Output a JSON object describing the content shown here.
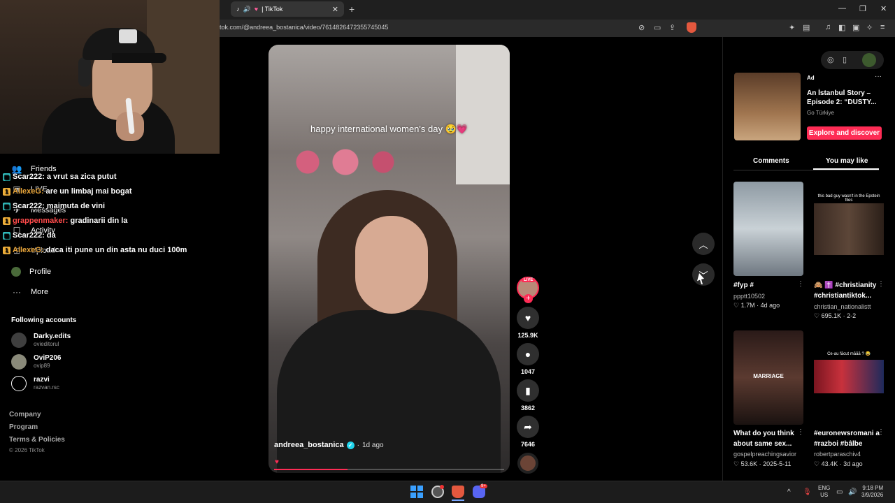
{
  "browser": {
    "tab_title": "| TikTok",
    "url": "tok.com/@andreea_bostanica/video/7614826472355745045",
    "tab_close": "✕",
    "new_tab": "+",
    "win_min": "—",
    "win_max": "❐",
    "win_close": "✕"
  },
  "sidebar": {
    "items": [
      {
        "label": "Friends",
        "icon": "friends-icon"
      },
      {
        "label": "LIVE",
        "icon": "live-icon"
      },
      {
        "label": "Messages",
        "icon": "messages-icon"
      },
      {
        "label": "Activity",
        "icon": "activity-icon"
      },
      {
        "label": "Upload",
        "icon": "upload-icon"
      },
      {
        "label": "Profile",
        "icon": "profile-icon"
      },
      {
        "label": "More",
        "icon": "more-icon"
      }
    ],
    "following_title": "Following accounts",
    "accounts": [
      {
        "name": "Darky.edits",
        "handle": "ovieditorul"
      },
      {
        "name": "OviP206",
        "handle": "ovip89"
      },
      {
        "name": "razvi",
        "handle": "razvan.rsc"
      }
    ],
    "footer": [
      "Company",
      "Program",
      "Terms & Policies"
    ],
    "copyright": "© 2026 TikTok"
  },
  "chat": [
    {
      "user": "Scar222:",
      "msg": "a vrut sa zica putut",
      "color": "#ffffff",
      "badge": "▦",
      "badge_color": "#33c2c2"
    },
    {
      "user": "AllexeG:",
      "msg": "are un limbaj mai bogat",
      "color": "#e8a53a",
      "badge": "1",
      "badge_color": "#f0b03a"
    },
    {
      "user": "Scar222:",
      "msg": "maimuta de vini",
      "color": "#ffffff",
      "badge": "▦",
      "badge_color": "#33c2c2"
    },
    {
      "user": "grappenmaker:",
      "msg": "gradinarii din la",
      "color": "#ff4b4b",
      "badge": "1",
      "badge_color": "#f0b03a"
    },
    {
      "user": "Scar222:",
      "msg": "da",
      "color": "#ffffff",
      "badge": "▦",
      "badge_color": "#33c2c2"
    },
    {
      "user": "AllexeG:",
      "msg": "daca iti pune un din asta nu duci 100m",
      "color": "#e8a53a",
      "badge": "1",
      "badge_color": "#f0b03a"
    }
  ],
  "video": {
    "caption": "happy international women's day 🥹💗",
    "author": "andreea_bostanica",
    "verified": "✓",
    "time": "1d ago",
    "separator": "·",
    "heart": "♥",
    "progress": 0.32
  },
  "actions": {
    "live_badge": "LIVE",
    "follow": "+",
    "likes": "125.9K",
    "comments": "1047",
    "saves": "3862",
    "shares": "7646"
  },
  "right": {
    "ad_label": "Ad",
    "ad_title": "An İstanbul Story – Episode 2: “DUSTY...",
    "ad_sponsor": "Go Türkiye",
    "ad_cta": "Explore and discover",
    "tabs": [
      "Comments",
      "You may like"
    ],
    "active_tab": "You may like",
    "cards": [
      {
        "title": "#fyp #",
        "user": "ppptt10502",
        "likes": "1.7M",
        "date": "4d ago"
      },
      {
        "title": "🙈 ✝️ #christianity #christiantiktok...",
        "user": "christian_nationalistt",
        "likes": "695.1K",
        "date": "2-2",
        "overlay": "this bad guy wasn't in the Epstein files"
      },
      {
        "title": "What do you think about same sex...",
        "user": "gospelpreachingsavior",
        "likes": "53.6K",
        "date": "2025-5-11",
        "overlay": "MARRIAGE"
      },
      {
        "title": "#euronewsromani a #razboi #bâlbe",
        "user": "robertparaschiv4",
        "likes": "43.4K",
        "date": "3d ago",
        "overlay": "Ce-au făcut măăă ? 😂"
      }
    ]
  },
  "taskbar": {
    "lang": "ENG",
    "region": "US",
    "time": "9:18 PM",
    "date": "3/9/2026",
    "chevron": "^",
    "discord_badge": "9+"
  },
  "colors": {
    "accent": "#fe2c55",
    "verified": "#20d5ec"
  }
}
